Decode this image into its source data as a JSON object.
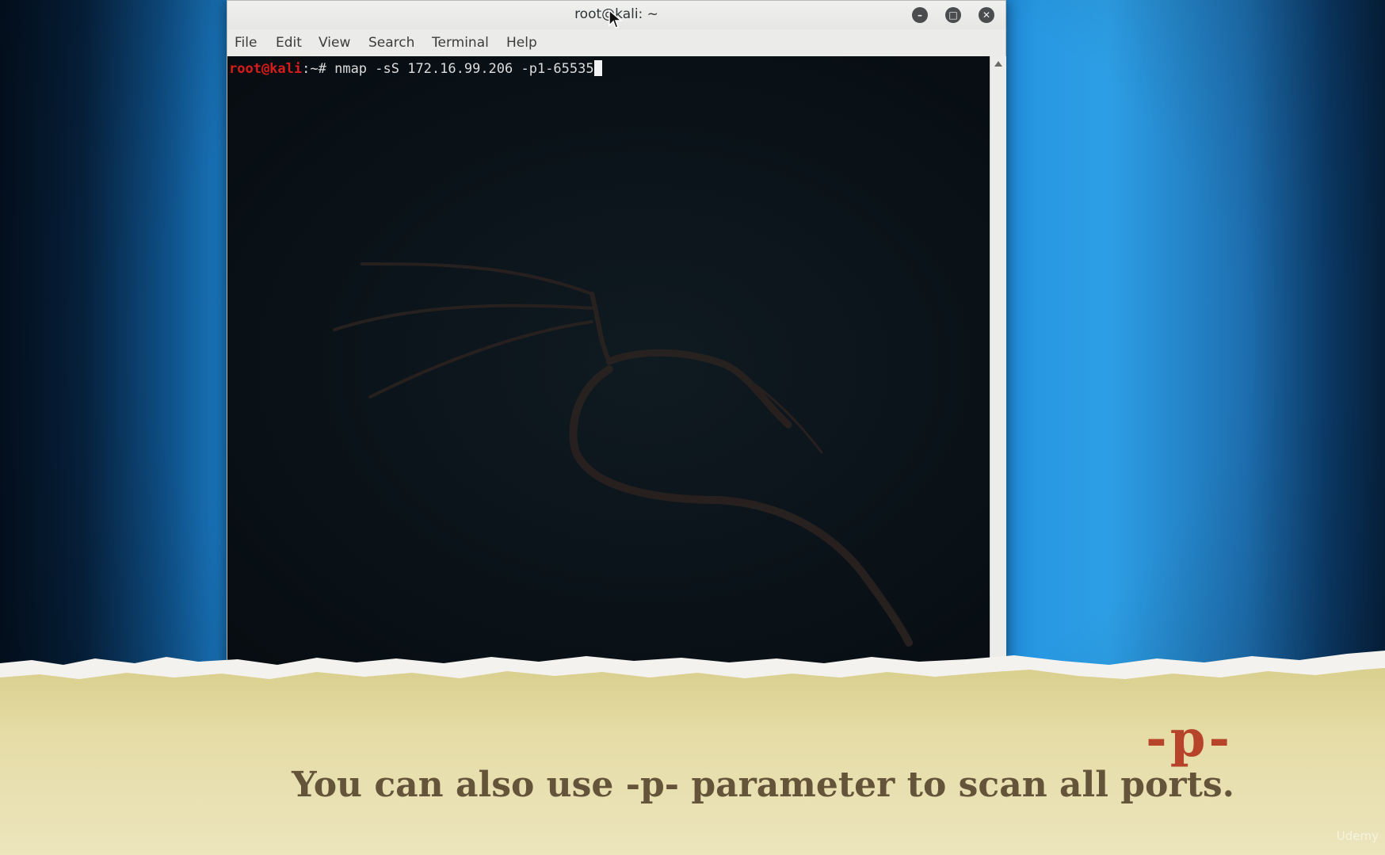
{
  "window": {
    "title": "root@kali: ~"
  },
  "menu": {
    "items": [
      "File",
      "Edit",
      "View",
      "Search",
      "Terminal",
      "Help"
    ]
  },
  "terminal": {
    "prompt_user": "root@kali",
    "prompt_sep": ":",
    "prompt_path": "~# ",
    "command": "nmap -sS 172.16.99.206 -p1-65535"
  },
  "banner": {
    "heading": "-p-",
    "caption": "You can also use -p- parameter to scan all ports."
  },
  "watermark": "Udemy",
  "colors": {
    "prompt_user": "#d81b1b",
    "banner_heading": "#b7442a",
    "banner_caption": "#63543a",
    "paper": "#e4dba3"
  }
}
